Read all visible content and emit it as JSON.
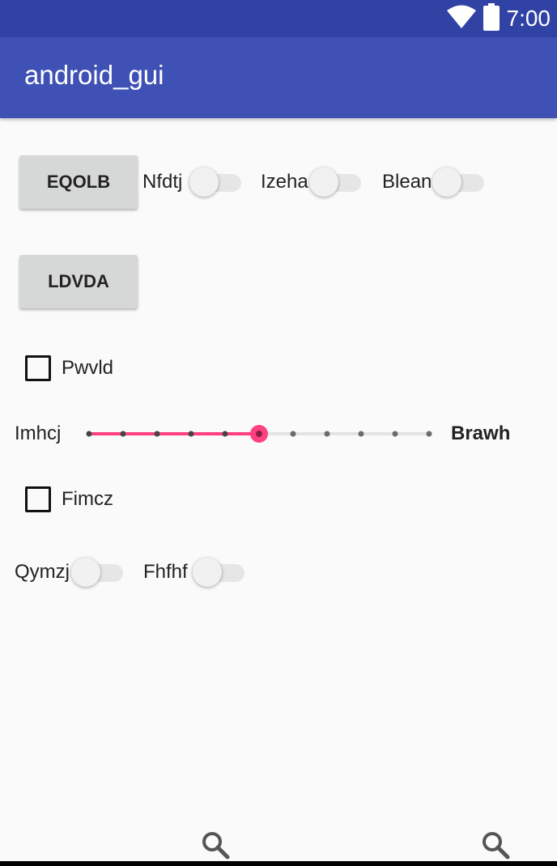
{
  "status_bar": {
    "time": "7:00",
    "icons": [
      "wifi-icon",
      "battery-icon"
    ]
  },
  "app_bar": {
    "title": "android_gui"
  },
  "buttons": {
    "first": "EQOLB",
    "second": "LDVDA"
  },
  "switches": {
    "row1": [
      {
        "label": "Nfdtj",
        "checked": false
      },
      {
        "label": "Izeha",
        "checked": false
      },
      {
        "label": "Blean",
        "checked": false
      }
    ],
    "row2": [
      {
        "label": "Qymzj",
        "checked": false
      },
      {
        "label": "Fhfhf",
        "checked": false
      }
    ]
  },
  "checkboxes": [
    {
      "label": "Pwvld",
      "checked": false
    },
    {
      "label": "Fimcz",
      "checked": false
    }
  ],
  "seekbar": {
    "left_label": "Imhcj",
    "right_label": "Brawh",
    "value": 5,
    "max": 10,
    "accent": "#ff4081"
  },
  "bottom_icons": [
    "search-icon",
    "search-icon"
  ],
  "colors": {
    "status_bar": "#3142a5",
    "app_bar": "#3f51b5",
    "accent": "#ff4081"
  }
}
